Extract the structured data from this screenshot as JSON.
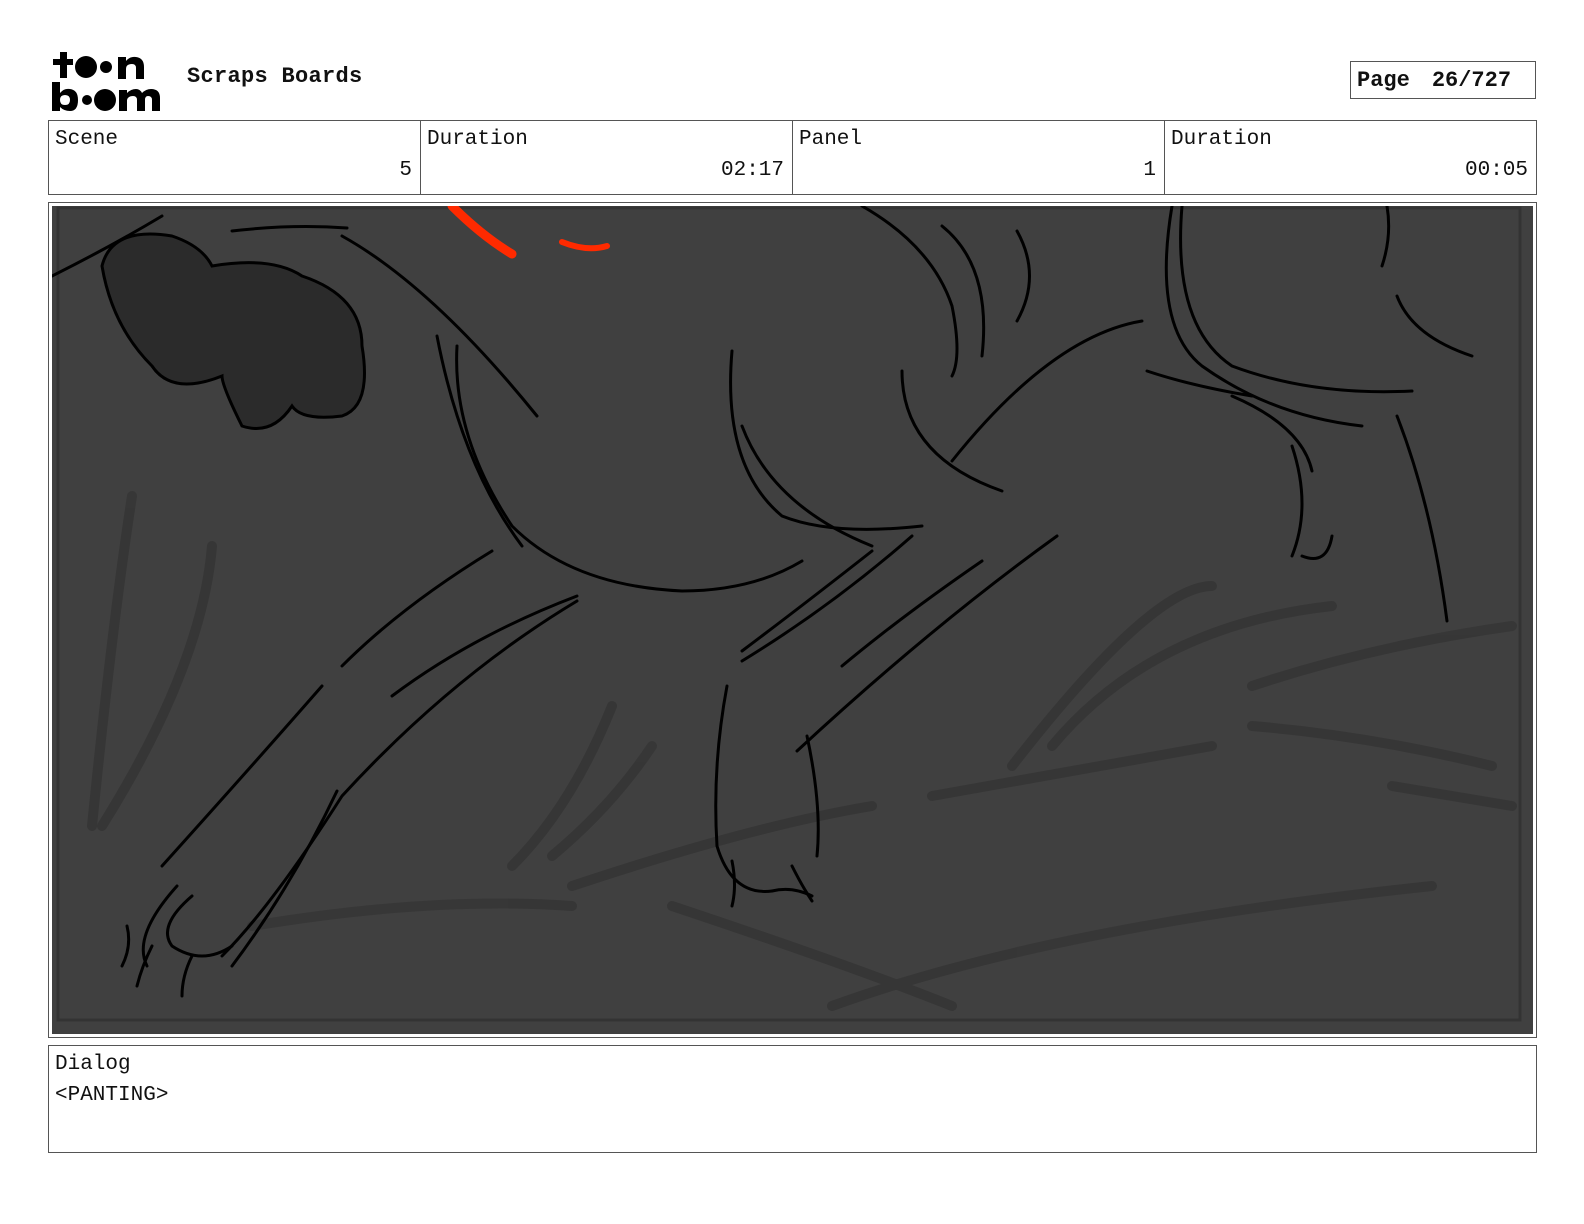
{
  "header": {
    "logo_text_top": "toon",
    "logo_text_bottom": "boom",
    "project_title": "Scraps Boards",
    "page_label": "Page",
    "page_value": "26/727"
  },
  "fields": [
    {
      "label": "Scene",
      "value": "5"
    },
    {
      "label": "Duration",
      "value": "02:17"
    },
    {
      "label": "Panel",
      "value": "1"
    },
    {
      "label": "Duration",
      "value": "00:05"
    }
  ],
  "dialog": {
    "label": "Dialog",
    "text": "<PANTING>"
  },
  "colors": {
    "panel_background": "#404040",
    "sketch_line": "#000000",
    "accent_red": "#ff2a00"
  }
}
